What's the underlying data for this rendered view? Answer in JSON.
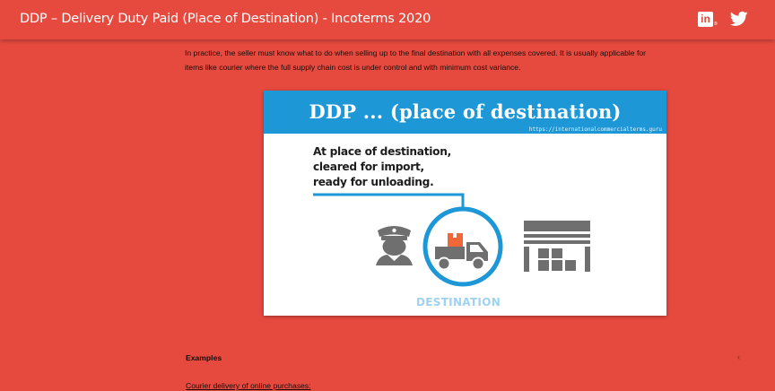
{
  "header": {
    "title": "DDP – Delivery Duty Paid (Place of Destination) - Incoterms 2020",
    "linkedin_icon": "linkedin-icon",
    "twitter_icon": "twitter-icon",
    "linkedin_letters": "in"
  },
  "article": {
    "intro_line_1": "In practice, the seller must know what to do when selling up to the final destination with all expenses covered. It is usually applicable for",
    "intro_line_2": "items like courier where the full supply chain cost is under control and with minimum cost variance.",
    "figure": {
      "title": "DDP ... (place of destination)",
      "url": "https://internationalcommercialterms.guru",
      "caption_line_1": "At place of destination,",
      "caption_line_2": "cleared for import,",
      "caption_line_3": "ready for unloading.",
      "destination_label": "DESTINATION",
      "icons": [
        "customs-officer-icon",
        "delivery-truck-icon",
        "warehouse-icon"
      ]
    },
    "examples_heading": "Examples",
    "example_1": "Courier delivery of online purchases:"
  },
  "colors": {
    "page_background": "#e64a3f",
    "figure_blue": "#1e97d6",
    "icon_gray": "#6f6f6f",
    "package_orange": "#f0683a"
  }
}
